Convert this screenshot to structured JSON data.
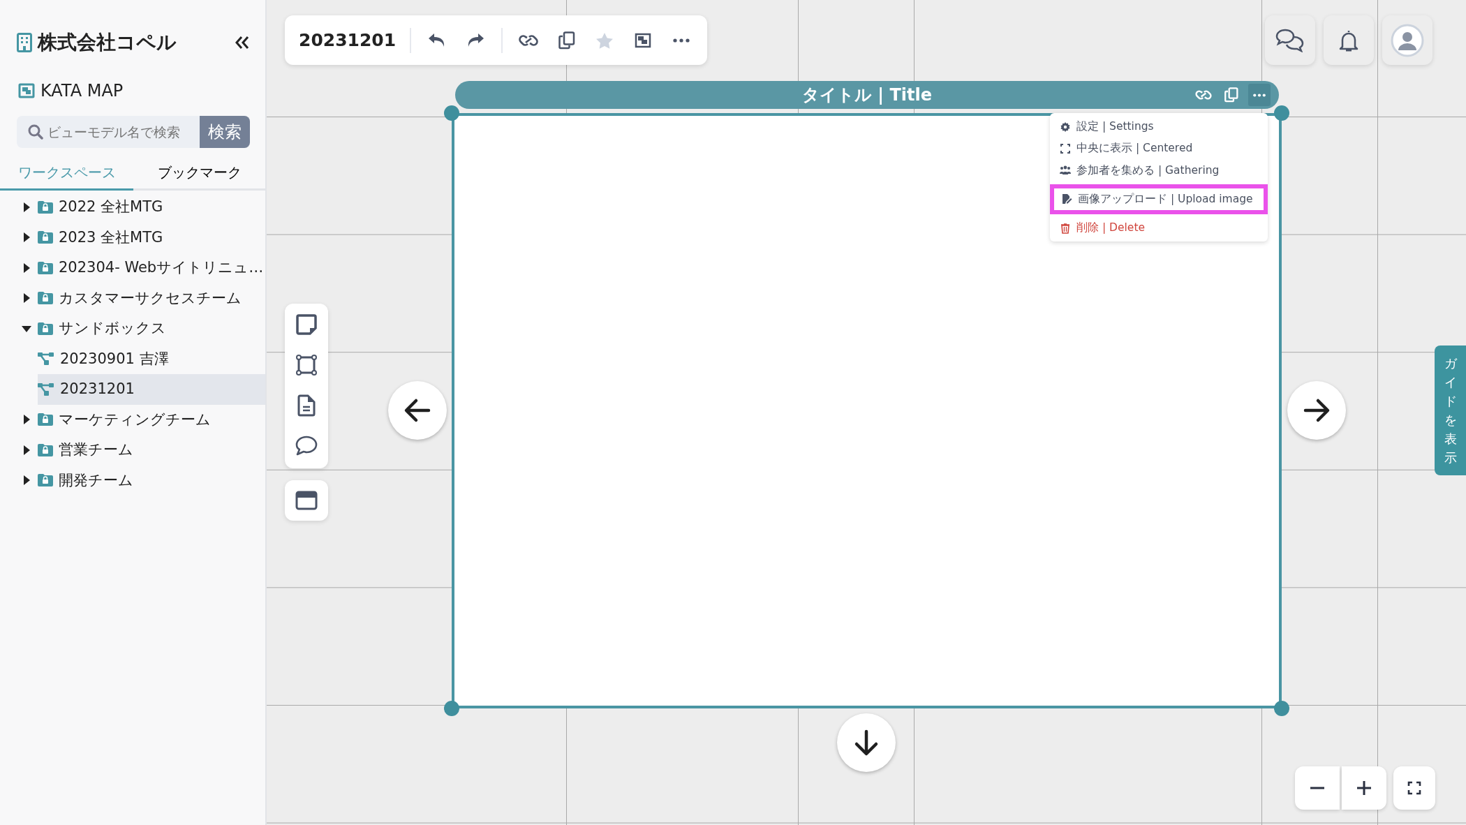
{
  "sidebar": {
    "company": "株式会社コペル",
    "app_title": "KATA MAP",
    "search": {
      "placeholder": "ビューモデル名で検索",
      "button": "検索"
    },
    "tabs": [
      {
        "label": "ワークスペース",
        "selected": true
      },
      {
        "label": "ブックマーク",
        "selected": false
      }
    ],
    "tree": [
      {
        "label": "2022 全社MTG",
        "kind": "folder",
        "expanded": false,
        "selected": false
      },
      {
        "label": "2023 全社MTG",
        "kind": "folder",
        "expanded": false,
        "selected": false
      },
      {
        "label": "202304- Webサイトリニュ…",
        "kind": "folder",
        "expanded": false,
        "selected": false
      },
      {
        "label": "カスタマーサクセスチーム",
        "kind": "folder",
        "expanded": false,
        "selected": false
      },
      {
        "label": "サンドボックス",
        "kind": "folder",
        "expanded": true,
        "selected": false,
        "children": [
          {
            "label": "20230901 吉澤",
            "kind": "map",
            "selected": false
          },
          {
            "label": "20231201",
            "kind": "map",
            "selected": true
          }
        ]
      },
      {
        "label": "マーケティングチーム",
        "kind": "folder",
        "expanded": false,
        "selected": false
      },
      {
        "label": "営業チーム",
        "kind": "folder",
        "expanded": false,
        "selected": false
      },
      {
        "label": "開発チーム",
        "kind": "folder",
        "expanded": false,
        "selected": false
      }
    ]
  },
  "toolbar": {
    "title": "20231201"
  },
  "frame": {
    "title": "タイトル | Title",
    "menu": [
      {
        "kind": "settings",
        "label": "設定 | Settings",
        "highlighted": false
      },
      {
        "kind": "center",
        "label": "中央に表示 | Centered",
        "highlighted": false
      },
      {
        "kind": "gather",
        "label": "参加者を集める | Gathering",
        "highlighted": false
      },
      {
        "kind": "upload",
        "label": "画像アップロード | Upload image",
        "highlighted": true
      },
      {
        "kind": "delete",
        "label": "削除 | Delete",
        "highlighted": false
      }
    ]
  },
  "guide_tab": {
    "label": "ガイドを表示"
  }
}
